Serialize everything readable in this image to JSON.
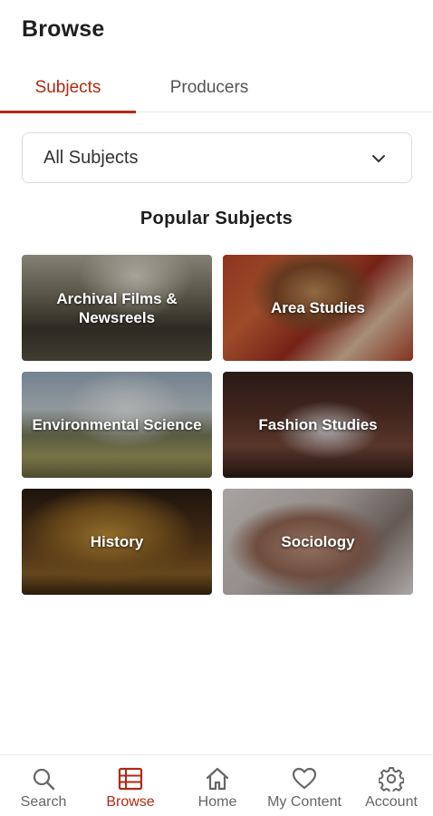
{
  "header": {
    "title": "Browse"
  },
  "tabs": [
    {
      "label": "Subjects",
      "active": true
    },
    {
      "label": "Producers",
      "active": false
    }
  ],
  "subject_select": {
    "selected": "All Subjects",
    "icon": "chevron-down-icon"
  },
  "section": {
    "title": "Popular Subjects"
  },
  "tiles": [
    {
      "label": "Archival Films & Newsreels"
    },
    {
      "label": "Area Studies"
    },
    {
      "label": "Environmental Science"
    },
    {
      "label": "Fashion Studies"
    },
    {
      "label": "History"
    },
    {
      "label": "Sociology"
    }
  ],
  "bottom_nav": [
    {
      "label": "Search",
      "icon": "search-icon",
      "active": false
    },
    {
      "label": "Browse",
      "icon": "browse-grid-icon",
      "active": true
    },
    {
      "label": "Home",
      "icon": "home-icon",
      "active": false
    },
    {
      "label": "My Content",
      "icon": "heart-icon",
      "active": false
    },
    {
      "label": "Account",
      "icon": "gear-icon",
      "active": false
    }
  ],
  "colors": {
    "accent": "#b02a12",
    "text": "#1e1e1e",
    "muted": "#666666"
  }
}
